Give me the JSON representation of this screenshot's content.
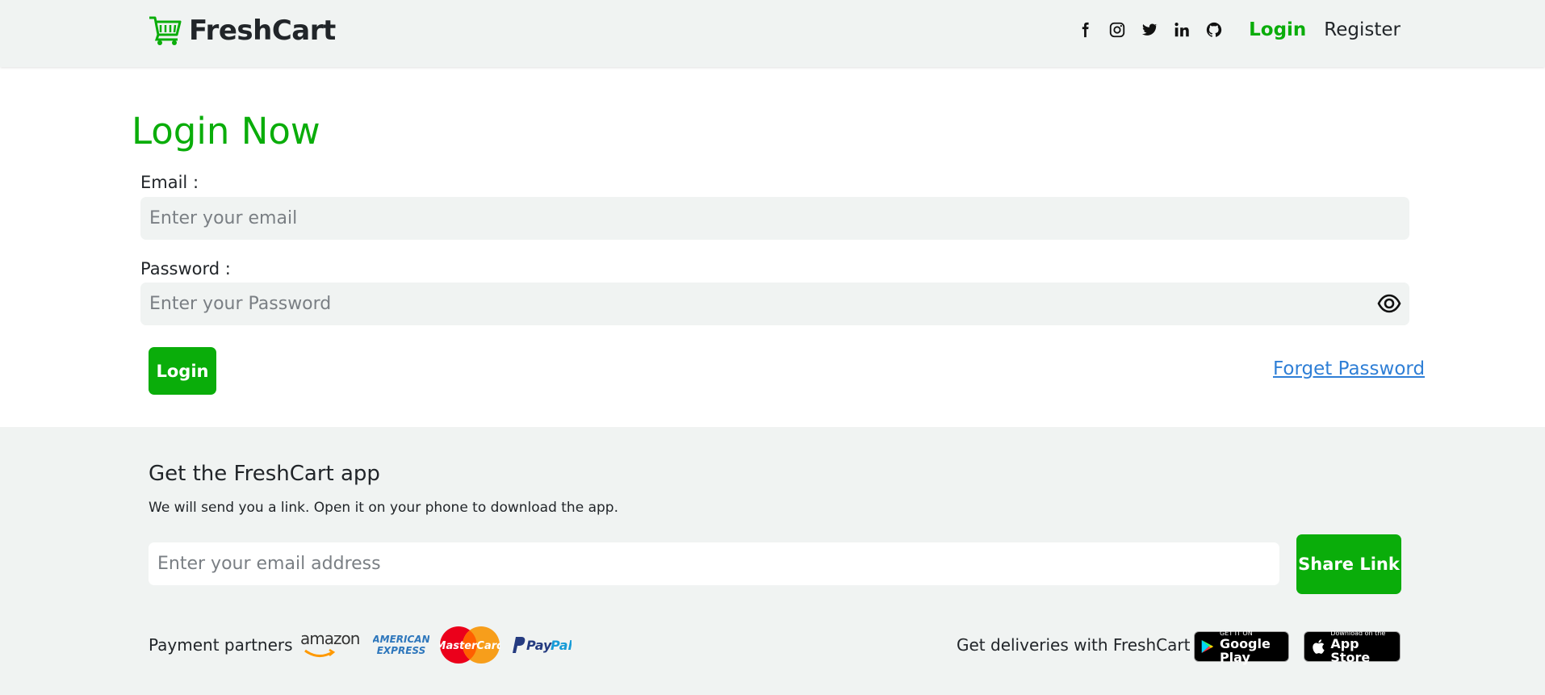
{
  "brand": {
    "name": "FreshCart",
    "icon": "shopping-cart-icon",
    "accent": "#0aad0a"
  },
  "nav": {
    "social_icons": [
      "facebook-icon",
      "instagram-icon",
      "twitter-icon",
      "linkedin-icon",
      "github-icon"
    ],
    "login_label": "Login",
    "register_label": "Register"
  },
  "login_form": {
    "title": "Login Now",
    "email_label": "Email :",
    "email_placeholder": "Enter your email",
    "email_value": "",
    "password_label": "Password :",
    "password_placeholder": "Enter your Password",
    "password_value": "",
    "toggle_icon": "eye-icon",
    "submit_label": "Login",
    "forget_label": "Forget Password"
  },
  "footer": {
    "app_title": "Get the FreshCart app",
    "app_subtitle": "We will send you a link. Open it on your phone to download the app.",
    "share_placeholder": "Enter your email address",
    "share_button": "Share Link",
    "payment_label": "Payment partners",
    "payment_logos": [
      {
        "name": "amazon-pay-logo",
        "text": "amazon pay"
      },
      {
        "name": "american-express-logo",
        "text": "AMERICAN EXPRESS"
      },
      {
        "name": "mastercard-logo",
        "text": "MasterCard"
      },
      {
        "name": "paypal-logo",
        "text": "PayPal"
      }
    ],
    "deliveries_label": "Get deliveries with FreshCart",
    "google_play": {
      "small": "GET IT ON",
      "big": "Google Play"
    },
    "app_store": {
      "small": "Download on the",
      "big": "App Store"
    }
  },
  "colors": {
    "accent": "#0aad0a",
    "nav_bg": "#f0f3f2",
    "link_blue": "#2f7fd6"
  }
}
